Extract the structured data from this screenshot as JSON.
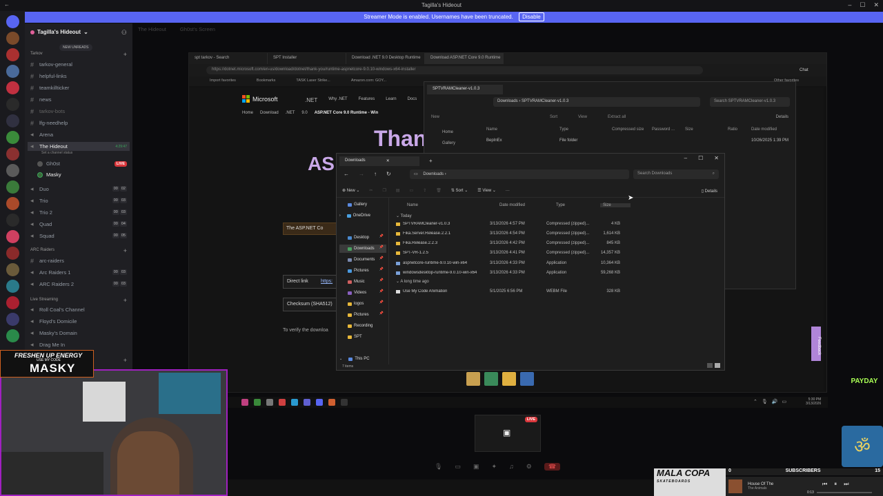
{
  "titlebar": {
    "title": "Tagilla's Hideout"
  },
  "streamer_banner": {
    "text": "Streamer Mode is enabled. Usernames have been truncated.",
    "button": "Disable"
  },
  "server": {
    "name": "Tagilla's Hideout",
    "new_unreads": "NEW UNREADS"
  },
  "channels": {
    "tarkov_cat": "Tarkov",
    "tarkov_general": "tarkov-general",
    "helpful_links": "helpful-links",
    "teamkilltracker": "teamkillticker",
    "news": "news",
    "tarkov_bots": "tarkov-bots",
    "lfg": "lfg-needhelp",
    "arena": "Arena",
    "hideout": "The Hideout",
    "hideout_time": "4:29:47",
    "hideout_status": "Set a channel status",
    "gh0st": "Gh0st",
    "masky": "Masky",
    "live": "LIVE",
    "duo": "Duo",
    "trio": "Trio",
    "trio2": "Trio 2",
    "quad": "Quad",
    "squad": "Squad",
    "arc_cat": "ARC Raiders",
    "arc_raiders": "arc-raiders",
    "arc1": "Arc Raiders 1",
    "arc2": "ARC Raiders 2",
    "live_cat": "Live Streaming",
    "roll_coal": "Roll Coal's Channel",
    "floyd": "Floyd's Domicile",
    "masky_domain": "Masky's Domain",
    "drag": "Drag Me In"
  },
  "voice_counts": {
    "duo": [
      "00",
      "02"
    ],
    "trio": [
      "00",
      "03"
    ],
    "trio2": [
      "00",
      "03"
    ],
    "quad": [
      "00",
      "04"
    ],
    "squad": [
      "00",
      "05"
    ],
    "arc1": [
      "00",
      "03"
    ],
    "arc2": [
      "00",
      "03"
    ]
  },
  "discord_top": {
    "title": "The Hideout",
    "sub": "Gh0st's Screen"
  },
  "browser": {
    "tabs": [
      "spt tarkov - Search",
      "SPT Installer",
      "Download .NET 9.0 Desktop Runtime",
      "Download ASP.NET Core 9.0 Runtime"
    ],
    "url": "https://dotnet.microsoft.com/en-us/download/dotnet/thank-you/runtime-aspnetcore-9.0.10-windows-x64-installer",
    "favorites": [
      "Import favorites",
      "Bookmarks",
      "TASK Laser Strike...",
      "Amazon.com: GOY..."
    ],
    "other_favorites": "Other favorites",
    "chat": "Chat"
  },
  "ms_page": {
    "logo": "Microsoft",
    "brand": ".NET",
    "nav": [
      "Why .NET",
      "Features",
      "Learn",
      "Docs"
    ],
    "crumbs": [
      "Home",
      "Download",
      ".NET",
      "9.0",
      "ASP.NET Core 9.0 Runtime - Win"
    ],
    "thanks": "Than",
    "as": "AS",
    "asp_box": "The ASP.NET Co",
    "direct_link": "Direct link",
    "https": "https:",
    "checksum": "Checksum (SHA512)",
    "verify": "To verify the downloa",
    "feedback": "Feedback"
  },
  "explorer_back": {
    "tab": "SPTVRAMCleaner-v1.0.3",
    "path": [
      "Downloads",
      "SPTVRAMCleaner-v1.0.3"
    ],
    "search": "Search SPTVRAMCleaner-v1.0.3",
    "tools": [
      "New",
      "Sort",
      "View",
      "Extract all"
    ],
    "details": "Details",
    "side": [
      "Home",
      "Gallery"
    ],
    "headers": [
      "Name",
      "Type",
      "Compressed size",
      "Password ...",
      "Size",
      "Ratio",
      "Date modified"
    ],
    "row": {
      "name": "BepInEx",
      "type": "File folder",
      "date": "10/26/2025 1:39 PM"
    }
  },
  "explorer": {
    "tab": "Downloads",
    "path": "Downloads",
    "search": "Search Downloads",
    "tools": {
      "new": "New",
      "sort": "Sort",
      "view": "View"
    },
    "details": "Details",
    "sidebar": [
      "Gallery",
      "OneDrive",
      "Desktop",
      "Downloads",
      "Documents",
      "Pictures",
      "Music",
      "Videos",
      "logos",
      "Pictures",
      "Recording",
      "SPT",
      "This PC"
    ],
    "headers": {
      "name": "Name",
      "date": "Date modified",
      "type": "Type",
      "size": "Size"
    },
    "group_today": "Today",
    "group_old": "A long time ago",
    "rows": [
      {
        "name": "SPTVRAMCleaner-v1.0.3",
        "date": "3/13/2026 4:57 PM",
        "type": "Compressed (zipped)...",
        "size": "4 KB"
      },
      {
        "name": "Fika.Server.Release.2.2.1",
        "date": "3/13/2026 4:54 PM",
        "type": "Compressed (zipped)...",
        "size": "1,614 KB"
      },
      {
        "name": "Fika.Release.2.2.3",
        "date": "3/13/2026 4:42 PM",
        "type": "Compressed (zipped)...",
        "size": "845 KB"
      },
      {
        "name": "SPT-VR-1.2.5",
        "date": "3/13/2026 4:41 PM",
        "type": "Compressed (zipped)...",
        "size": "14,357 KB"
      },
      {
        "name": "aspnetcore-runtime-9.0.10-win-x64",
        "date": "3/13/2026 4:33 PM",
        "type": "Application",
        "size": "10,364 KB"
      },
      {
        "name": "windowsdesktop-runtime-9.0.10-win-x64",
        "date": "3/13/2026 4:33 PM",
        "type": "Application",
        "size": "59,268 KB"
      }
    ],
    "old_rows": [
      {
        "name": "Use My Code Animation",
        "date": "5/1/2025 6:56 PM",
        "type": "WEBM File",
        "size": "328 KB"
      }
    ],
    "status": "7 items"
  },
  "clock": {
    "time": "5:30 PM",
    "date": "3/13/2026"
  },
  "overlay": {
    "energy1": "FRESHEN UP ENERGY",
    "energy2": "USE MY CODE",
    "energy3": "MASKY",
    "live": "LIVE",
    "payday": "PAYDAY",
    "malacopa": "MALA COPA",
    "malacopa_sub": "SKATEBOARDS",
    "subs_left": "0",
    "subs_label": "SUBSCRIBERS",
    "subs_right": "15",
    "song": "House Of The",
    "artist": "The Animals",
    "time": "0:13"
  },
  "colors": {
    "discord_blurple": "#5865f2",
    "live_red": "#da373c",
    "folder": "#e8b83a",
    "accent_purple": "#c9a8e8"
  }
}
